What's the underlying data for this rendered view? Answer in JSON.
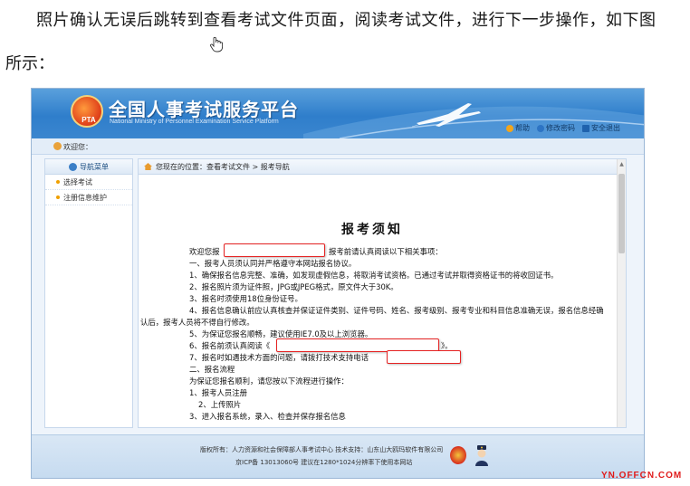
{
  "intro": {
    "line1": "照片确认无误后跳转到查看考试文件页面，阅读考试文件，进行下一步操作，如下图",
    "line2": "所示："
  },
  "banner": {
    "logo_text": "PTA",
    "title": "全国人事考试服务平台",
    "subtitle": "National Ministry of Personnel Examination Service Platform"
  },
  "toplinks": {
    "help": "帮助",
    "change_password": "修改密码",
    "logout": "安全退出"
  },
  "welcome": "欢迎您：",
  "sidebar": {
    "header": "导航菜单",
    "items": [
      "选择考试",
      "注册信息维护"
    ]
  },
  "breadcrumb": "您现在的位置：查看考试文件 > 报考导航",
  "doc": {
    "title": "报考须知",
    "lines": [
      "欢迎您报",
      "报考前请认真阅读以下相关事项：",
      "一、报考人员须认同并严格遵守本网站报名协议。",
      "1、确保报名信息完整、准确，如发现虚假信息，将取消考试资格。已通过考试并取得资格证书的将收回证书。",
      "2、报名照片须为证件照，JPG或JPEG格式，原文件大于30K。",
      "3、报名时须使用18位身份证号。",
      "4、报名信息确认前应认真核查并保证证件类别、证件号码、姓名、报考级别、报考专业和科目信息准确无误，报名信息经确",
      "认后，报考人员将不得自行修改。",
      "5、为保证您报名顺畅，建议使用IE7.0及以上浏览器。",
      "6、报名前须认真阅读《",
      "》。",
      "7、报名时如遇技术方面的问题，请拨打技术支持电话",
      "二、报名流程",
      "为保证您报名顺利，请您按以下流程进行操作：",
      "1、报考人员注册",
      "2、上传照片",
      "3、进入报名系统，录入、检查并保存报名信息"
    ]
  },
  "footer": {
    "line1": "版权所有：人力资源和社会保障部人事考试中心  技术支持：山东山大鸥玛软件有限公司",
    "line2": "京ICP备 13013060号  建议在1280*1024分辨率下使用本网站"
  },
  "watermark": "YN.OFFCN.COM"
}
